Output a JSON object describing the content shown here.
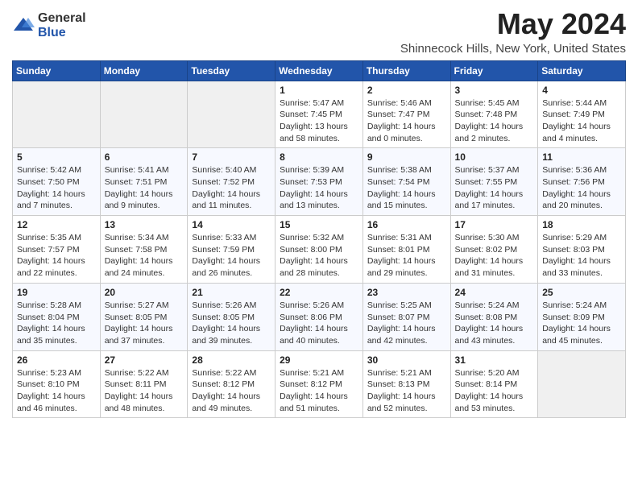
{
  "logo": {
    "general": "General",
    "blue": "Blue"
  },
  "title": "May 2024",
  "location": "Shinnecock Hills, New York, United States",
  "days_of_week": [
    "Sunday",
    "Monday",
    "Tuesday",
    "Wednesday",
    "Thursday",
    "Friday",
    "Saturday"
  ],
  "weeks": [
    [
      {
        "day": "",
        "empty": true
      },
      {
        "day": "",
        "empty": true
      },
      {
        "day": "",
        "empty": true
      },
      {
        "day": "1",
        "sunrise": "Sunrise: 5:47 AM",
        "sunset": "Sunset: 7:45 PM",
        "daylight": "Daylight: 13 hours and 58 minutes."
      },
      {
        "day": "2",
        "sunrise": "Sunrise: 5:46 AM",
        "sunset": "Sunset: 7:47 PM",
        "daylight": "Daylight: 14 hours and 0 minutes."
      },
      {
        "day": "3",
        "sunrise": "Sunrise: 5:45 AM",
        "sunset": "Sunset: 7:48 PM",
        "daylight": "Daylight: 14 hours and 2 minutes."
      },
      {
        "day": "4",
        "sunrise": "Sunrise: 5:44 AM",
        "sunset": "Sunset: 7:49 PM",
        "daylight": "Daylight: 14 hours and 4 minutes."
      }
    ],
    [
      {
        "day": "5",
        "sunrise": "Sunrise: 5:42 AM",
        "sunset": "Sunset: 7:50 PM",
        "daylight": "Daylight: 14 hours and 7 minutes."
      },
      {
        "day": "6",
        "sunrise": "Sunrise: 5:41 AM",
        "sunset": "Sunset: 7:51 PM",
        "daylight": "Daylight: 14 hours and 9 minutes."
      },
      {
        "day": "7",
        "sunrise": "Sunrise: 5:40 AM",
        "sunset": "Sunset: 7:52 PM",
        "daylight": "Daylight: 14 hours and 11 minutes."
      },
      {
        "day": "8",
        "sunrise": "Sunrise: 5:39 AM",
        "sunset": "Sunset: 7:53 PM",
        "daylight": "Daylight: 14 hours and 13 minutes."
      },
      {
        "day": "9",
        "sunrise": "Sunrise: 5:38 AM",
        "sunset": "Sunset: 7:54 PM",
        "daylight": "Daylight: 14 hours and 15 minutes."
      },
      {
        "day": "10",
        "sunrise": "Sunrise: 5:37 AM",
        "sunset": "Sunset: 7:55 PM",
        "daylight": "Daylight: 14 hours and 17 minutes."
      },
      {
        "day": "11",
        "sunrise": "Sunrise: 5:36 AM",
        "sunset": "Sunset: 7:56 PM",
        "daylight": "Daylight: 14 hours and 20 minutes."
      }
    ],
    [
      {
        "day": "12",
        "sunrise": "Sunrise: 5:35 AM",
        "sunset": "Sunset: 7:57 PM",
        "daylight": "Daylight: 14 hours and 22 minutes."
      },
      {
        "day": "13",
        "sunrise": "Sunrise: 5:34 AM",
        "sunset": "Sunset: 7:58 PM",
        "daylight": "Daylight: 14 hours and 24 minutes."
      },
      {
        "day": "14",
        "sunrise": "Sunrise: 5:33 AM",
        "sunset": "Sunset: 7:59 PM",
        "daylight": "Daylight: 14 hours and 26 minutes."
      },
      {
        "day": "15",
        "sunrise": "Sunrise: 5:32 AM",
        "sunset": "Sunset: 8:00 PM",
        "daylight": "Daylight: 14 hours and 28 minutes."
      },
      {
        "day": "16",
        "sunrise": "Sunrise: 5:31 AM",
        "sunset": "Sunset: 8:01 PM",
        "daylight": "Daylight: 14 hours and 29 minutes."
      },
      {
        "day": "17",
        "sunrise": "Sunrise: 5:30 AM",
        "sunset": "Sunset: 8:02 PM",
        "daylight": "Daylight: 14 hours and 31 minutes."
      },
      {
        "day": "18",
        "sunrise": "Sunrise: 5:29 AM",
        "sunset": "Sunset: 8:03 PM",
        "daylight": "Daylight: 14 hours and 33 minutes."
      }
    ],
    [
      {
        "day": "19",
        "sunrise": "Sunrise: 5:28 AM",
        "sunset": "Sunset: 8:04 PM",
        "daylight": "Daylight: 14 hours and 35 minutes."
      },
      {
        "day": "20",
        "sunrise": "Sunrise: 5:27 AM",
        "sunset": "Sunset: 8:05 PM",
        "daylight": "Daylight: 14 hours and 37 minutes."
      },
      {
        "day": "21",
        "sunrise": "Sunrise: 5:26 AM",
        "sunset": "Sunset: 8:05 PM",
        "daylight": "Daylight: 14 hours and 39 minutes."
      },
      {
        "day": "22",
        "sunrise": "Sunrise: 5:26 AM",
        "sunset": "Sunset: 8:06 PM",
        "daylight": "Daylight: 14 hours and 40 minutes."
      },
      {
        "day": "23",
        "sunrise": "Sunrise: 5:25 AM",
        "sunset": "Sunset: 8:07 PM",
        "daylight": "Daylight: 14 hours and 42 minutes."
      },
      {
        "day": "24",
        "sunrise": "Sunrise: 5:24 AM",
        "sunset": "Sunset: 8:08 PM",
        "daylight": "Daylight: 14 hours and 43 minutes."
      },
      {
        "day": "25",
        "sunrise": "Sunrise: 5:24 AM",
        "sunset": "Sunset: 8:09 PM",
        "daylight": "Daylight: 14 hours and 45 minutes."
      }
    ],
    [
      {
        "day": "26",
        "sunrise": "Sunrise: 5:23 AM",
        "sunset": "Sunset: 8:10 PM",
        "daylight": "Daylight: 14 hours and 46 minutes."
      },
      {
        "day": "27",
        "sunrise": "Sunrise: 5:22 AM",
        "sunset": "Sunset: 8:11 PM",
        "daylight": "Daylight: 14 hours and 48 minutes."
      },
      {
        "day": "28",
        "sunrise": "Sunrise: 5:22 AM",
        "sunset": "Sunset: 8:12 PM",
        "daylight": "Daylight: 14 hours and 49 minutes."
      },
      {
        "day": "29",
        "sunrise": "Sunrise: 5:21 AM",
        "sunset": "Sunset: 8:12 PM",
        "daylight": "Daylight: 14 hours and 51 minutes."
      },
      {
        "day": "30",
        "sunrise": "Sunrise: 5:21 AM",
        "sunset": "Sunset: 8:13 PM",
        "daylight": "Daylight: 14 hours and 52 minutes."
      },
      {
        "day": "31",
        "sunrise": "Sunrise: 5:20 AM",
        "sunset": "Sunset: 8:14 PM",
        "daylight": "Daylight: 14 hours and 53 minutes."
      },
      {
        "day": "",
        "empty": true
      }
    ]
  ]
}
